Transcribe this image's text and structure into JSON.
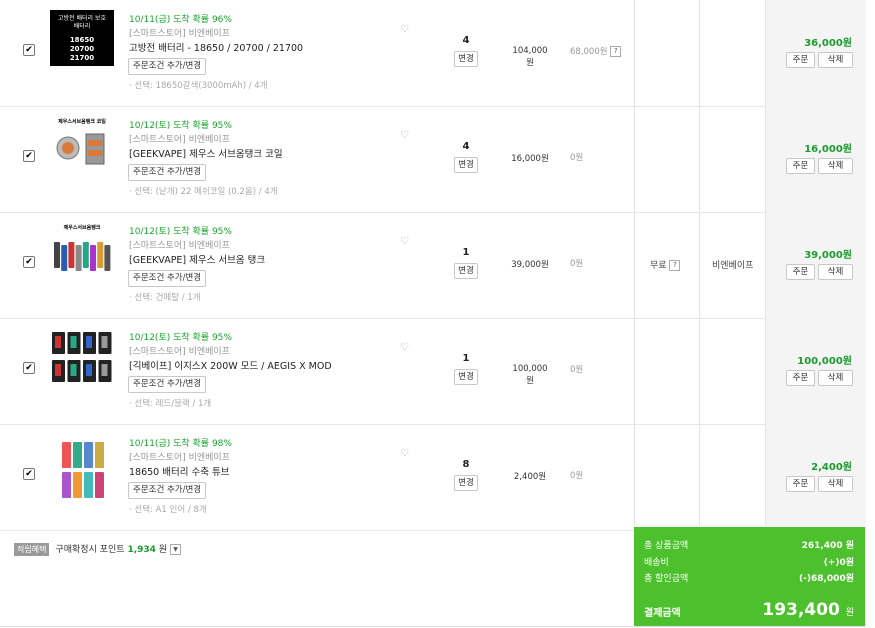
{
  "items": [
    {
      "eta": "10/11(금) 도착 확률 96%",
      "seller": "[스마트스토어] 비엔베이프",
      "name": "고방전 배터리 - 18650 / 20700 / 21700",
      "option_btn": "주문조건 추가/변경",
      "option": "· 선택: 18650갈색(3000mAh) / 4개",
      "qty": "4",
      "change": "변경",
      "price": "104,000원",
      "discount": "68,000원",
      "total": "36,000원",
      "order": "주문",
      "delete": "삭제",
      "thumb": {
        "type": "battery",
        "lines": [
          "고방전 배터리 보호",
          "배터리",
          "18650",
          "20700",
          "21700"
        ]
      }
    },
    {
      "eta": "10/12(토) 도착 확률 95%",
      "seller": "[스마트스토어] 비엔베이프",
      "name": "[GEEKVAPE] 제우스 서브옴탱크 코일",
      "option_btn": "주문조건 추가/변경",
      "option": "· 선택: (낱개) 22 메쉬코일 (0.2옴) / 4개",
      "qty": "4",
      "change": "변경",
      "price": "16,000원",
      "discount": "0원",
      "total": "16,000원",
      "order": "주문",
      "delete": "삭제",
      "thumb": {
        "type": "coil",
        "lines": [
          "제우스서브옴탱크 코일"
        ]
      }
    },
    {
      "eta": "10/12(토) 도착 확률 95%",
      "seller": "[스마트스토어] 비엔베이프",
      "name": "[GEEKVAPE] 제우스 서브옴 탱크",
      "option_btn": "주문조건 추가/변경",
      "option": "· 선택: 건메탈 / 1개",
      "qty": "1",
      "change": "변경",
      "price": "39,000원",
      "discount": "0원",
      "total": "39,000원",
      "order": "주문",
      "delete": "삭제",
      "thumb": {
        "type": "tank",
        "lines": [
          "제우스서브옴탱크"
        ]
      }
    },
    {
      "eta": "10/12(토) 도착 확률 95%",
      "seller": "[스마트스토어] 비엔베이프",
      "name": "[긱베이프] 이지스X 200W 모드 / AEGIS X MOD",
      "option_btn": "주문조건 추가/변경",
      "option": "· 선택: 레드/블랙 / 1개",
      "qty": "1",
      "change": "변경",
      "price": "100,000원",
      "discount": "0원",
      "total": "100,000원",
      "order": "주문",
      "delete": "삭제",
      "thumb": {
        "type": "mod",
        "lines": []
      }
    },
    {
      "eta": "10/11(금) 도착 확률 98%",
      "seller": "[스마트스토어] 비엔베이프",
      "name": "18650 배터리 수축 튜브",
      "option_btn": "주문조건 추가/변경",
      "option": "· 선택: A1 인어 / 8개",
      "qty": "8",
      "change": "변경",
      "price": "2,400원",
      "discount": "0원",
      "total": "2,400원",
      "order": "주문",
      "delete": "삭제",
      "thumb": {
        "type": "wrap",
        "lines": []
      }
    }
  ],
  "shipping": {
    "fee": "무료",
    "seller": "비엔베이프"
  },
  "points": {
    "tag": "적립혜택",
    "label": "구매확정시 포인트",
    "value": "1,934",
    "unit": "원"
  },
  "summary": {
    "product_label": "총 상품금액",
    "product_value": "261,400 원",
    "shipping_label": "배송비",
    "shipping_value": "(+)0원",
    "discount_label": "총 할인금액",
    "discount_value": "(-)68,000원",
    "final_label": "결제금액",
    "final_value": "193,400",
    "final_unit": "원"
  },
  "colors": {
    "accent": "#4cc02d",
    "total_green": "#1a9d2d",
    "eta_green": "#19a52c"
  }
}
